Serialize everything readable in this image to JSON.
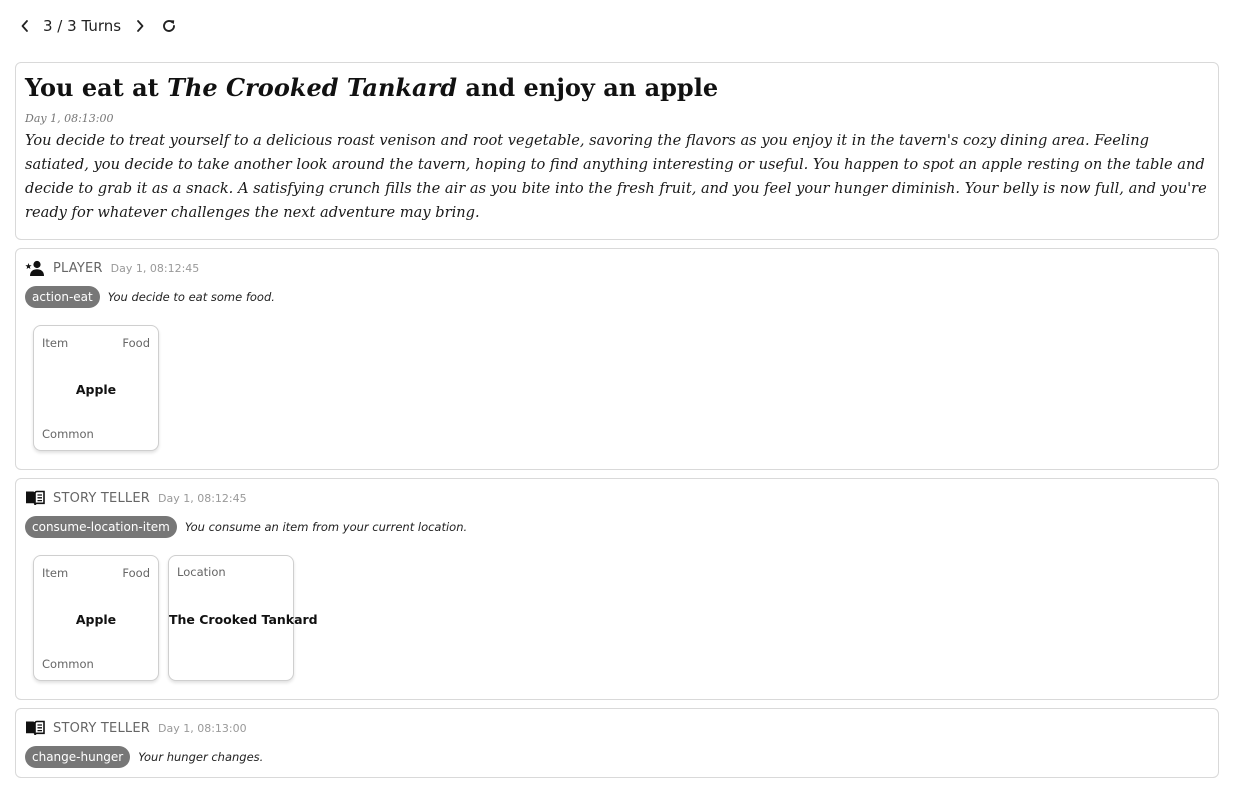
{
  "nav": {
    "label": "3 / 3 Turns",
    "prev_icon": "chevron-left-icon",
    "next_icon": "chevron-right-icon",
    "refresh_icon": "refresh-icon"
  },
  "summary": {
    "title_prefix": "You eat at ",
    "title_place": "The Crooked Tankard",
    "title_suffix": " and enjoy an apple",
    "time": "Day 1, 08:13:00",
    "text": "You decide to treat yourself to a delicious roast venison and root vegetable, savoring the flavors as you enjoy it in the tavern's cozy dining area. Feeling satiated, you decide to take another look around the tavern, hoping to find anything interesting or useful. You happen to spot an apple resting on the table and decide to grab it as a snack. A satisfying crunch fills the air as you bite into the fresh fruit, and you feel your hunger diminish. Your belly is now full, and you're ready for whatever challenges the next adventure may bring."
  },
  "events": [
    {
      "role": "PLAYER",
      "icon": "person-star-icon",
      "time": "Day 1, 08:12:45",
      "action": "action-eat",
      "description": "You decide to eat some food.",
      "tiles": [
        {
          "type": "Item",
          "category": "Food",
          "name": "Apple",
          "rarity": "Common"
        }
      ]
    },
    {
      "role": "STORY TELLER",
      "icon": "book-icon",
      "time": "Day 1, 08:12:45",
      "action": "consume-location-item",
      "description": "You consume an item from your current location.",
      "tiles": [
        {
          "type": "Item",
          "category": "Food",
          "name": "Apple",
          "rarity": "Common"
        },
        {
          "type": "Location",
          "category": "",
          "name": "The Crooked Tankard",
          "rarity": ""
        }
      ]
    },
    {
      "role": "STORY TELLER",
      "icon": "book-icon",
      "time": "Day 1, 08:13:00",
      "action": "change-hunger",
      "description": "Your hunger changes.",
      "tiles": []
    }
  ]
}
